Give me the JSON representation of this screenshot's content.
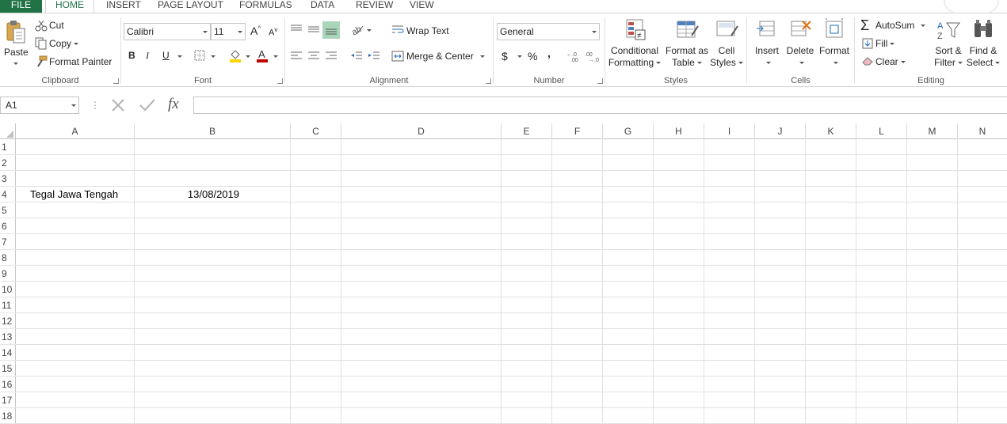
{
  "tabs": {
    "file": "FILE",
    "home": "HOME",
    "insert": "INSERT",
    "page_layout": "PAGE LAYOUT",
    "formulas": "FORMULAS",
    "data": "DATA",
    "review": "REVIEW",
    "view": "VIEW"
  },
  "clipboard": {
    "paste": "Paste",
    "cut": "Cut",
    "copy": "Copy",
    "format_painter": "Format Painter",
    "label": "Clipboard"
  },
  "font": {
    "name": "Calibri",
    "size": "11",
    "bold": "B",
    "italic": "I",
    "underline": "U",
    "label": "Font"
  },
  "alignment": {
    "wrap_text": "Wrap Text",
    "merge_center": "Merge & Center",
    "label": "Alignment"
  },
  "number": {
    "format": "General",
    "currency": "$",
    "percent": "%",
    "comma": ",",
    "label": "Number"
  },
  "styles": {
    "conditional_line1": "Conditional",
    "conditional_line2": "Formatting",
    "format_table_line1": "Format as",
    "format_table_line2": "Table",
    "cell_styles_line1": "Cell",
    "cell_styles_line2": "Styles",
    "label": "Styles"
  },
  "cells_group": {
    "insert": "Insert",
    "delete": "Delete",
    "format": "Format",
    "label": "Cells"
  },
  "editing": {
    "autosum": "AutoSum",
    "fill": "Fill",
    "clear": "Clear",
    "sort_line1": "Sort &",
    "sort_line2": "Filter",
    "find_line1": "Find &",
    "find_line2": "Select",
    "label": "Editing"
  },
  "formula_bar": {
    "name_box": "A1",
    "fx": "fx",
    "value": ""
  },
  "grid": {
    "columns": [
      "A",
      "B",
      "C",
      "D",
      "E",
      "F",
      "G",
      "H",
      "I",
      "J",
      "K",
      "L",
      "M",
      "N"
    ],
    "rows": [
      "1",
      "2",
      "3",
      "4",
      "5",
      "6",
      "7",
      "8",
      "9",
      "10",
      "11",
      "12",
      "13",
      "14",
      "15",
      "16",
      "17",
      "18"
    ],
    "cell_a4": "Tegal Jawa Tengah",
    "cell_b4": "13/08/2019"
  },
  "colors": {
    "accent": "#217346",
    "gridline": "#e1e1e1"
  }
}
